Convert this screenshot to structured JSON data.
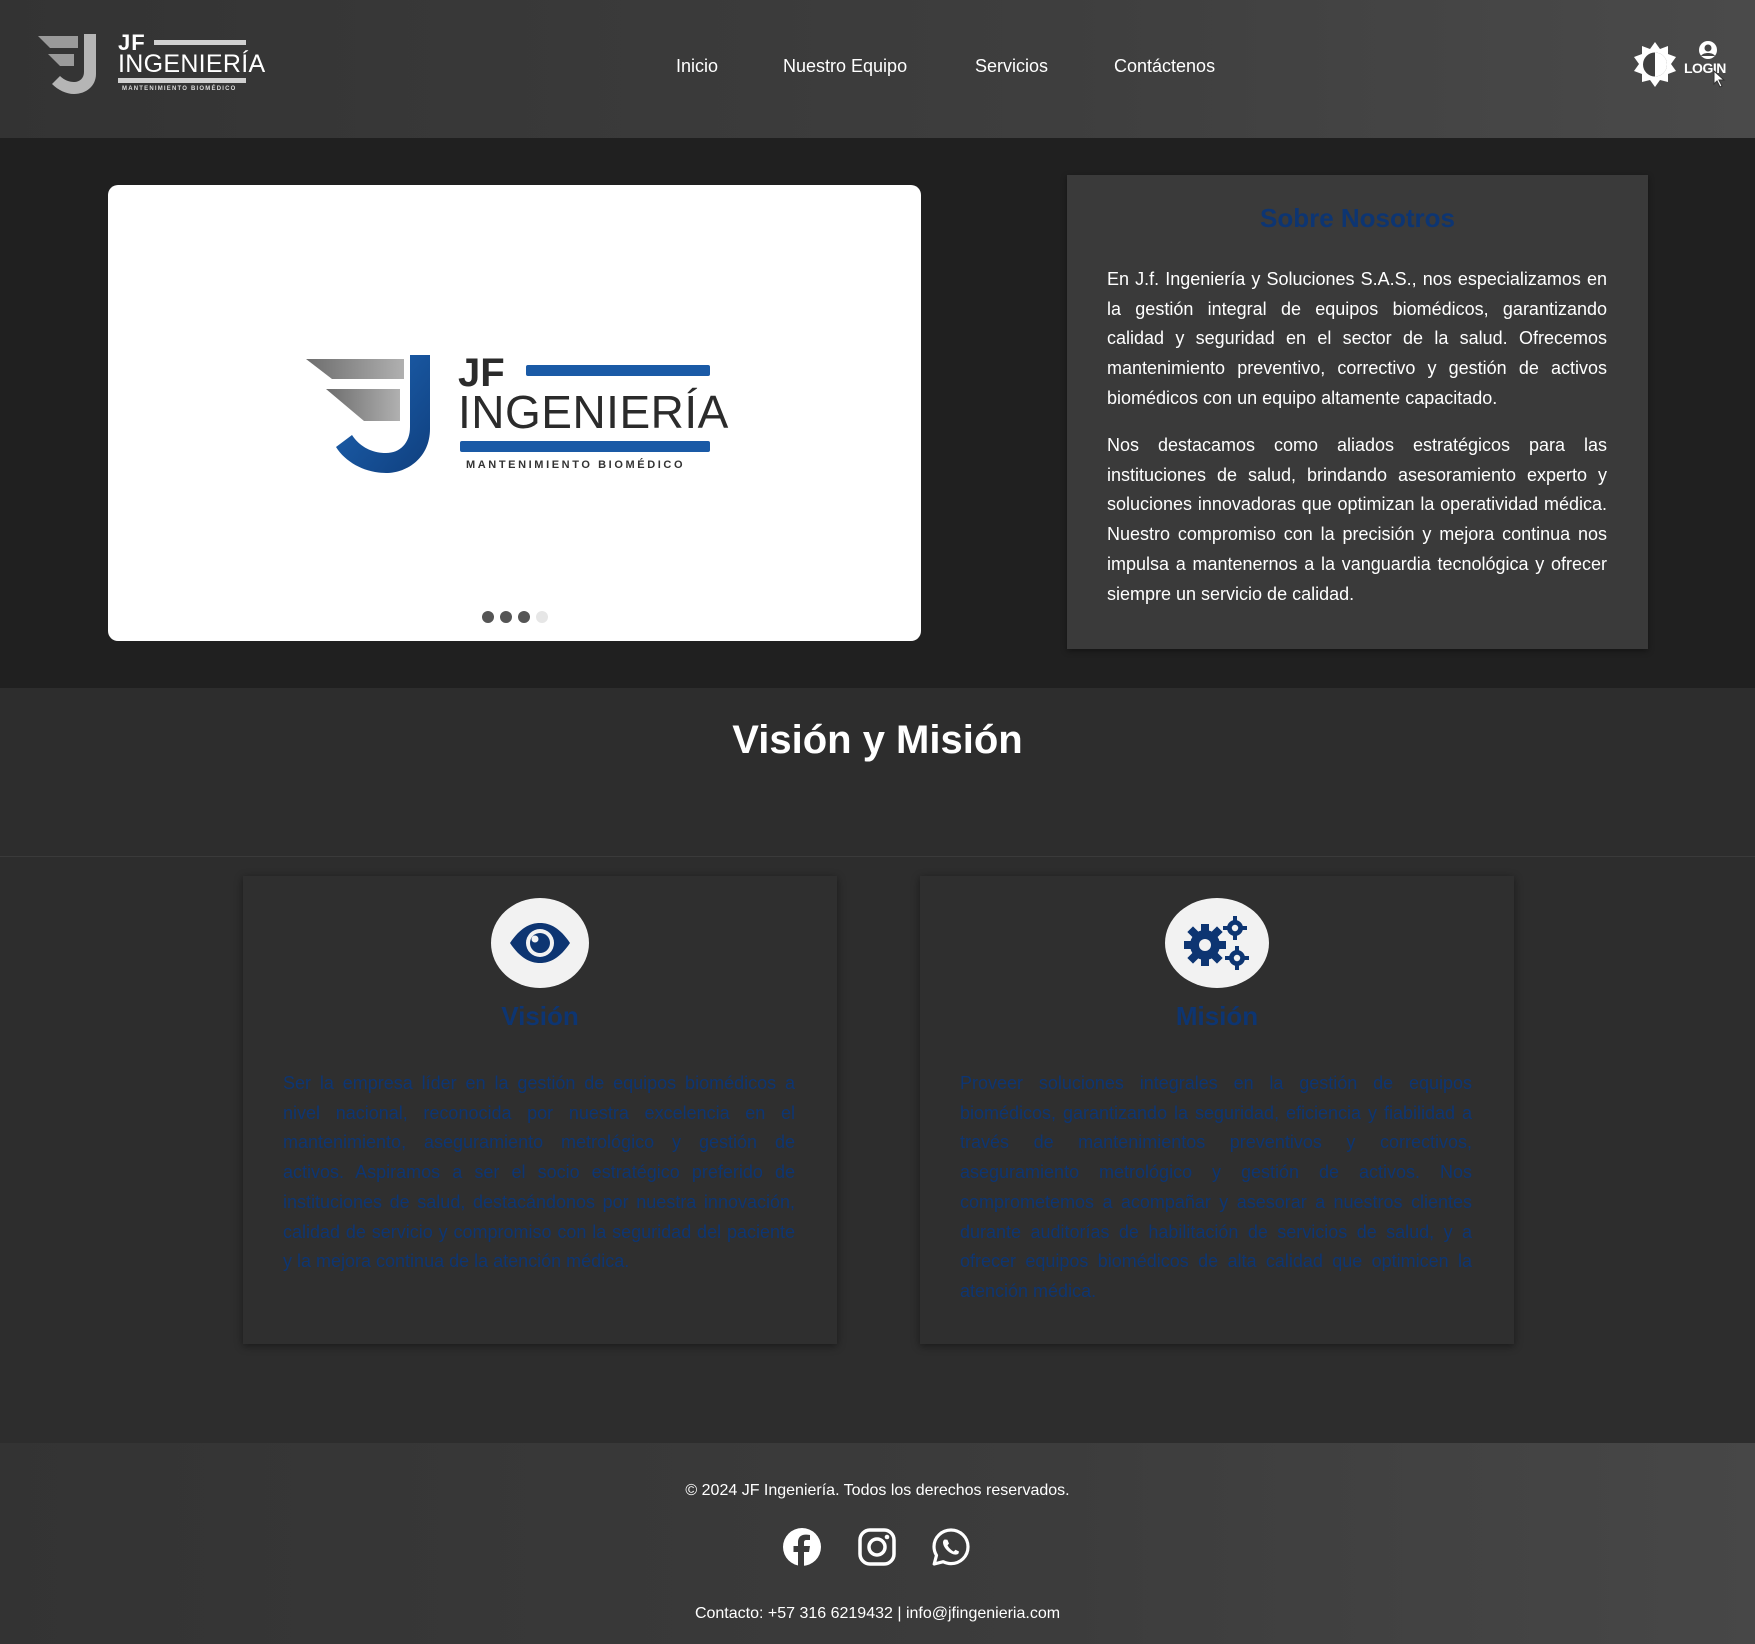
{
  "header": {
    "logo": {
      "jf": "JF",
      "name": "INGENIERÍA",
      "tagline": "MANTENIMIENTO BIOMÉDICO"
    },
    "nav": [
      {
        "label": "Inicio"
      },
      {
        "label": "Nuestro Equipo"
      },
      {
        "label": "Servicios"
      },
      {
        "label": "Contáctenos"
      }
    ],
    "theme_icon": "theme-toggle-icon",
    "login_label": "LOGIN"
  },
  "carousel": {
    "logo": {
      "jf": "JF",
      "name": "INGENIERÍA",
      "tagline": "MANTENIMIENTO BIOMÉDICO"
    },
    "slides_total": 4,
    "active_indicators": 3
  },
  "about": {
    "title": "Sobre Nosotros",
    "paragraphs": [
      "En J.f. Ingeniería y Soluciones S.A.S., nos especializamos en la gestión integral de equipos biomédicos, garantizando calidad y seguridad en el sector de la salud. Ofrecemos mantenimiento preventivo, correctivo y gestión de activos biomédicos con un equipo altamente capacitado.",
      "Nos destacamos como aliados estratégicos para las instituciones de salud, brindando asesoramiento experto y soluciones innovadoras que optimizan la operatividad médica. Nuestro compromiso con la precisión y mejora continua nos impulsa a mantenernos a la vanguardia tecnológica y ofrecer siempre un servicio de calidad."
    ]
  },
  "vision_mision": {
    "title": "Visión y Misión",
    "vision": {
      "icon": "eye-icon",
      "title": "Visión",
      "text": "Ser la empresa líder en la gestión de equipos biomédicos a nivel nacional, reconocida por nuestra excelencia en el mantenimiento, aseguramiento metrológico y gestión de activos. Aspiramos a ser el socio estratégico preferido de instituciones de salud, destacándonos por nuestra innovación, calidad de servicio y compromiso con la seguridad del paciente y la mejora continua de la atención médica."
    },
    "mision": {
      "icon": "gears-icon",
      "title": "Misión",
      "text": "Proveer soluciones integrales en la gestión de equipos biomédicos, garantizando la seguridad, eficiencia y fiabilidad a través de mantenimientos preventivos y correctivos, aseguramiento metrológico y gestión de activos. Nos comprometemos a acompañar y asesorar a nuestros clientes durante auditorías de habilitación de servicios de salud, y a ofrecer equipos biomédicos de alta calidad que optimicen la atención médica."
    }
  },
  "footer": {
    "copyright": "© 2024 JF Ingeniería. Todos los derechos reservados.",
    "social": [
      {
        "icon": "facebook-icon"
      },
      {
        "icon": "instagram-icon"
      },
      {
        "icon": "whatsapp-icon"
      }
    ],
    "contact": "Contacto: +57 316 6219432 | info@jfingenieria.com"
  },
  "colors": {
    "brand_blue": "#0d3572",
    "logo_blue": "#1a5aa6",
    "header_bg": "#3a3a3a",
    "hero_bg": "#202020"
  }
}
